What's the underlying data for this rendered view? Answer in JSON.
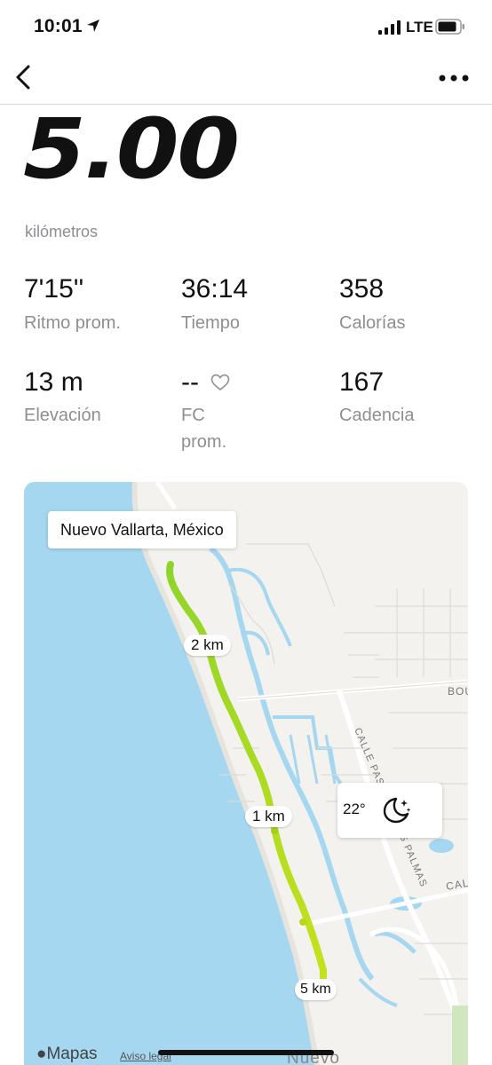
{
  "status_bar": {
    "time": "10:01",
    "network": "LTE"
  },
  "nav": {
    "back_icon": "chevron-left-icon",
    "more_icon": "more-dots-icon"
  },
  "run": {
    "distance": "5.00",
    "distance_unit": "kilómetros"
  },
  "stats": [
    {
      "value": "7'15''",
      "label": "Ritmo prom."
    },
    {
      "value": "36:14",
      "label": "Tiempo"
    },
    {
      "value": "358",
      "label": "Calorías"
    },
    {
      "value": "13 m",
      "label": "Elevación"
    },
    {
      "value": "--",
      "label": "FC\nprom."
    },
    {
      "value": "167",
      "label": "Cadencia"
    }
  ],
  "map": {
    "location": "Nuevo Vallarta, México",
    "markers": [
      "2 km",
      "1 km",
      "5 km"
    ],
    "route_color": "#a4d41c",
    "water_color": "#a5d7f0",
    "street_labels": [
      "BOU",
      "CALLE PASEO DE LAS PALMAS",
      "CAL"
    ],
    "city_label": "Nuevo",
    "weather": {
      "temp": "22°",
      "icon": "moon-stars-icon"
    },
    "attribution": "Mapas",
    "legal": "Aviso legal"
  }
}
